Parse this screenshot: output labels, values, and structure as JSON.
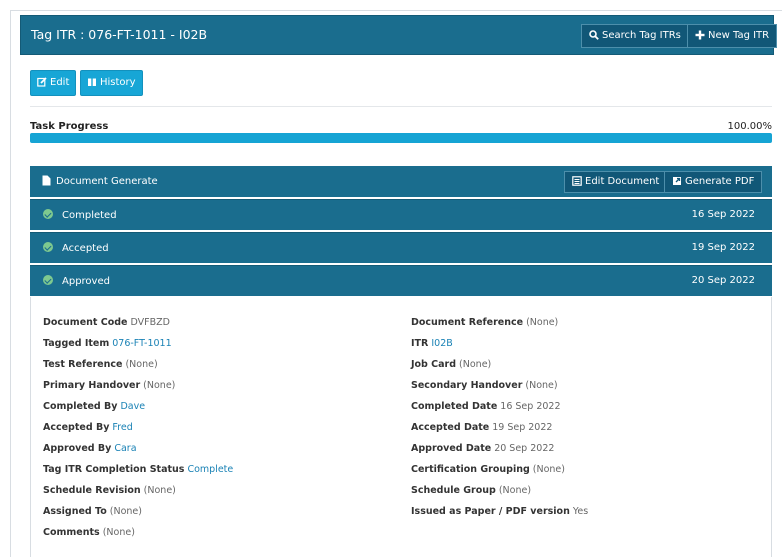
{
  "header": {
    "title": "Tag ITR : 076-FT-1011 - I02B",
    "search_label": "Search Tag ITRs",
    "new_label": "New Tag ITR"
  },
  "actions": {
    "edit_label": "Edit",
    "history_label": "History"
  },
  "progress": {
    "label": "Task Progress",
    "value_text": "100.00%",
    "value": 1.0
  },
  "document_generate": {
    "label": "Document Generate",
    "edit_document_label": "Edit Document",
    "generate_pdf_label": "Generate PDF"
  },
  "statuses": [
    {
      "label": "Completed",
      "date": "16 Sep 2022"
    },
    {
      "label": "Accepted",
      "date": "19 Sep 2022"
    },
    {
      "label": "Approved",
      "date": "20 Sep 2022"
    }
  ],
  "details": {
    "left": [
      {
        "key": "Document Code",
        "value": "DVFBZD"
      },
      {
        "key": "Tagged Item",
        "value": "076-FT-1011"
      },
      {
        "key": "Test Reference",
        "value": "(None)"
      },
      {
        "key": "Primary Handover",
        "value": "(None)"
      },
      {
        "key": "Completed By",
        "value": "Dave"
      },
      {
        "key": "Accepted By",
        "value": "Fred"
      },
      {
        "key": "Approved By",
        "value": "Cara"
      },
      {
        "key": "Tag ITR Completion Status",
        "value": "Complete"
      },
      {
        "key": "Schedule Revision",
        "value": "(None)"
      },
      {
        "key": "Assigned To",
        "value": "(None)"
      },
      {
        "key": "Comments",
        "value": "(None)"
      }
    ],
    "right": [
      {
        "key": "Document Reference",
        "value": "(None)"
      },
      {
        "key": "ITR",
        "value": "I02B"
      },
      {
        "key": "Job Card",
        "value": "(None)"
      },
      {
        "key": "Secondary Handover",
        "value": "(None)"
      },
      {
        "key": "Completed Date",
        "value": "16 Sep 2022"
      },
      {
        "key": "Accepted Date",
        "value": "19 Sep 2022"
      },
      {
        "key": "Approved Date",
        "value": "20 Sep 2022"
      },
      {
        "key": "Certification Grouping",
        "value": "(None)"
      },
      {
        "key": "Schedule Group",
        "value": "(None)"
      },
      {
        "key": "Issued as Paper / PDF version",
        "value": "Yes"
      }
    ]
  },
  "colors": {
    "header": "#1a6d8e",
    "accent": "#17a6d6",
    "link": "#1a82b5",
    "check": "#7ec98f"
  }
}
